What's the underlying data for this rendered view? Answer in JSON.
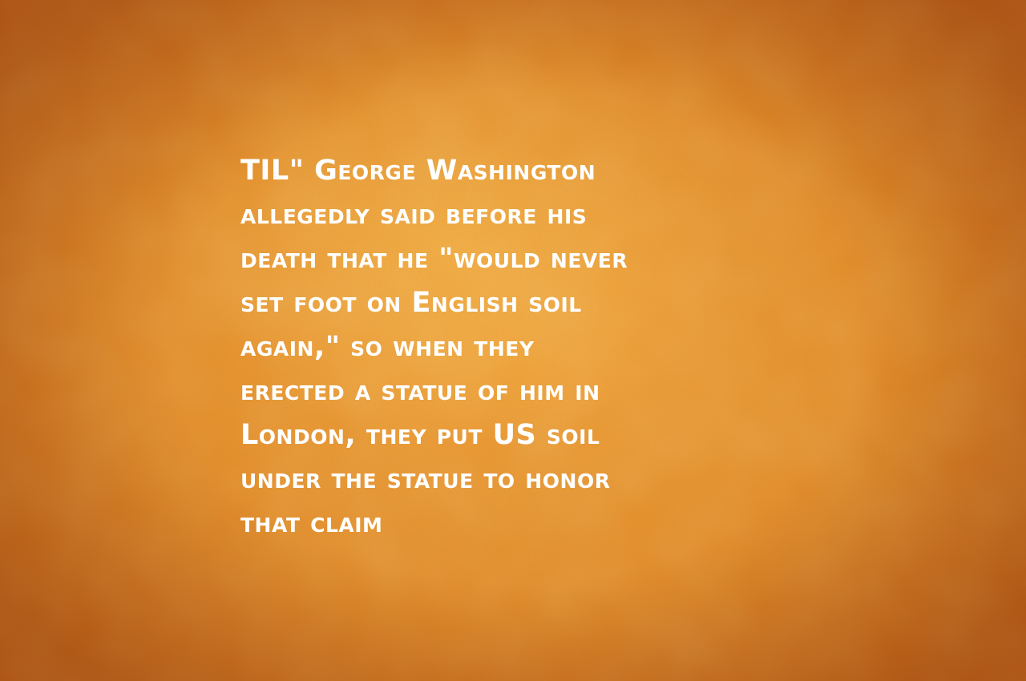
{
  "quote": {
    "lines": [
      "TIL\" George Washington",
      "allegedly said before his",
      "death that he \"would never",
      "set foot on English soil",
      "again,\" so when they",
      "erected a statue of him in",
      "London, they put US soil",
      "under the statue to honor",
      "that claim"
    ]
  },
  "colors": {
    "background": "#e58a2a",
    "highlight": "#ffc45a",
    "text": "#ffffff"
  }
}
